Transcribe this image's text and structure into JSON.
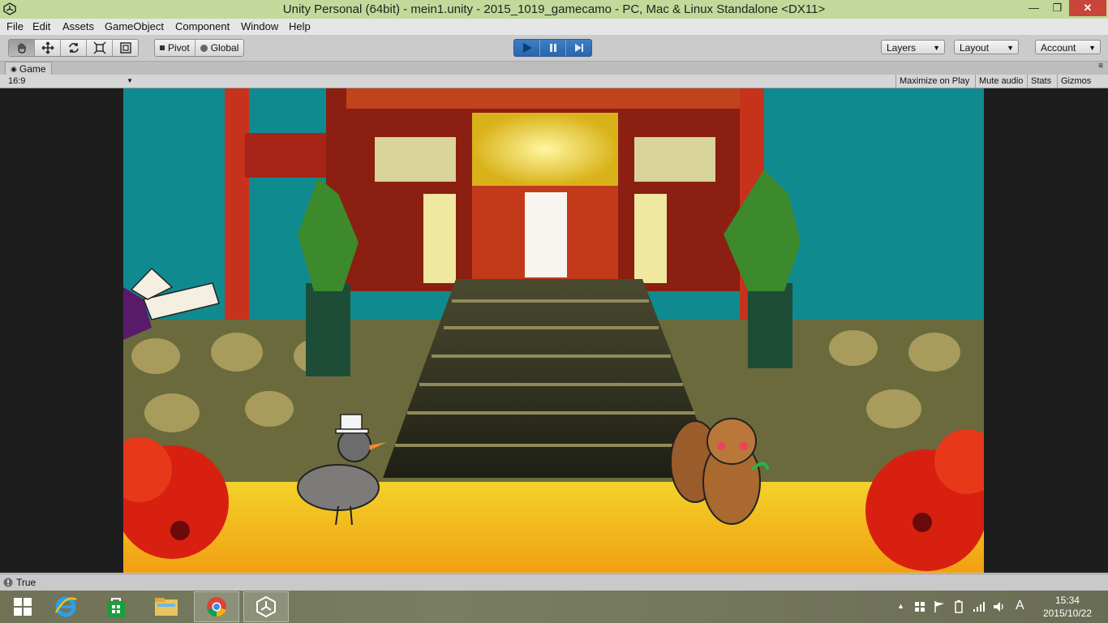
{
  "window": {
    "title": "Unity Personal (64bit) - mein1.unity - 2015_1019_gamecamo - PC, Mac & Linux Standalone <DX11>",
    "minimize": "—",
    "maximize": "❐",
    "close": "✕"
  },
  "menu": [
    "File",
    "Edit",
    "Assets",
    "GameObject",
    "Component",
    "Window",
    "Help"
  ],
  "toolbar": {
    "pivot_label": "Pivot",
    "global_label": "Global",
    "layers_label": "Layers",
    "layout_label": "Layout",
    "account_label": "Account",
    "play_state": "playing"
  },
  "game_tab": {
    "tab_label": "Game",
    "aspect_label": "16:9",
    "maximize_label": "Maximize on Play",
    "mute_label": "Mute audio",
    "stats_label": "Stats",
    "gizmos_label": "Gizmos"
  },
  "status": {
    "text": "True"
  },
  "taskbar": {
    "ime": "A",
    "time": "15:34",
    "date": "2015/10/22",
    "apps": [
      "windows-start",
      "internet-explorer",
      "windows-store",
      "file-explorer",
      "chrome",
      "unity"
    ]
  },
  "colors": {
    "titlebar": "#c2d99b",
    "play_blue": "#2a66aa",
    "sky": "#0f8a8f",
    "floor": "#f5b21a"
  }
}
